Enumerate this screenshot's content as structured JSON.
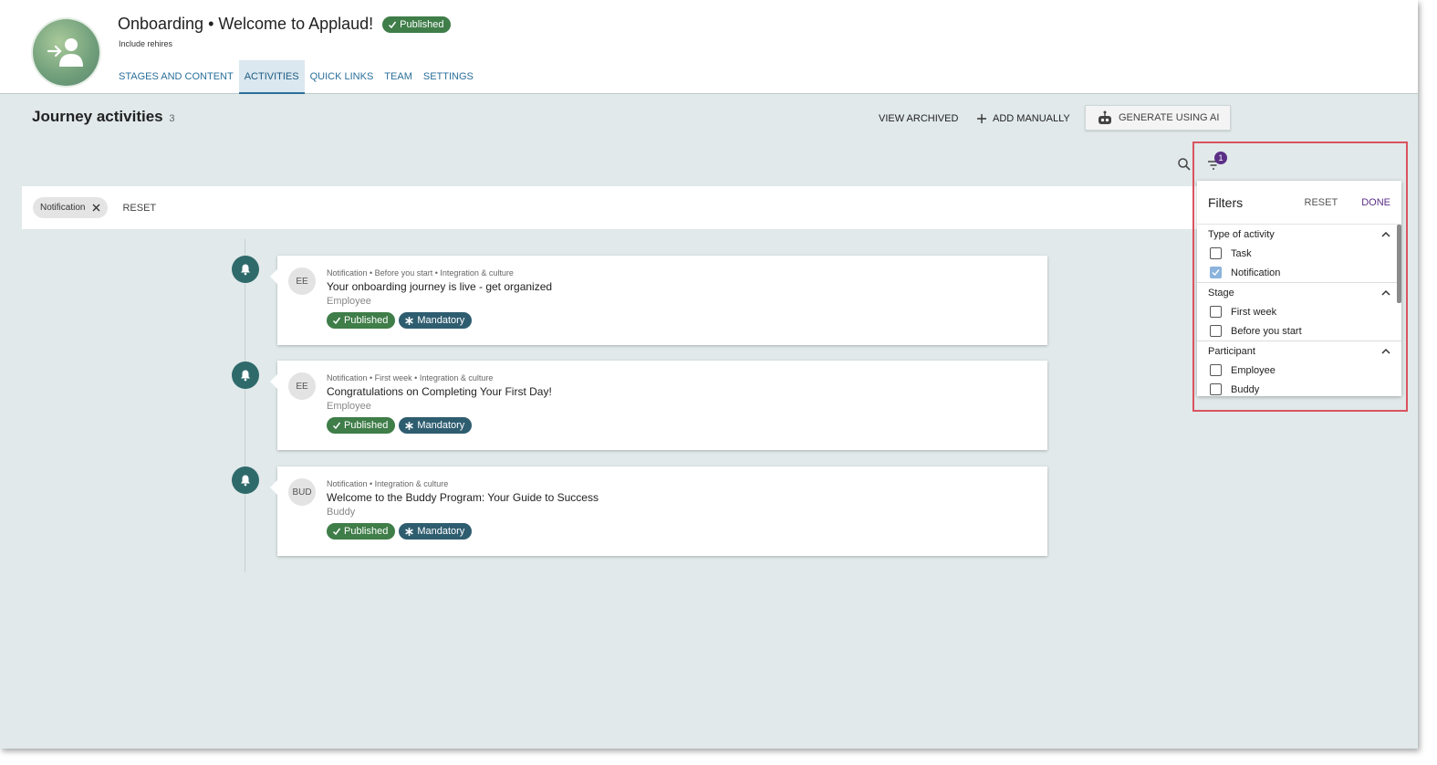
{
  "header": {
    "title": "Onboarding • Welcome to Applaud!",
    "status_badge": "Published",
    "subtitle": "Include rehires",
    "tabs": [
      {
        "label": "STAGES AND CONTENT"
      },
      {
        "label": "ACTIVITIES",
        "active": true
      },
      {
        "label": "QUICK LINKS"
      },
      {
        "label": "TEAM"
      },
      {
        "label": "SETTINGS"
      }
    ]
  },
  "toolbar": {
    "section_title": "Journey activities",
    "count": "3",
    "view_archived": "VIEW ARCHIVED",
    "add_manually": "ADD MANUALLY",
    "generate_ai": "GENERATE USING AI"
  },
  "chips": {
    "active_filter": "Notification",
    "reset": "RESET"
  },
  "filter_button": {
    "count": "1"
  },
  "activities": [
    {
      "initials": "EE",
      "meta": "Notification • Before you start • Integration & culture",
      "title": "Your onboarding journey is live - get organized",
      "role": "Employee",
      "status": "Published",
      "tag": "Mandatory"
    },
    {
      "initials": "EE",
      "meta": "Notification • First week • Integration & culture",
      "title": "Congratulations on Completing Your First Day!",
      "role": "Employee",
      "status": "Published",
      "tag": "Mandatory"
    },
    {
      "initials": "BUD",
      "meta": "Notification • Integration & culture",
      "title": "Welcome to the Buddy Program: Your Guide to Success",
      "role": "Buddy",
      "status": "Published",
      "tag": "Mandatory"
    }
  ],
  "filters_panel": {
    "title": "Filters",
    "reset": "RESET",
    "done": "DONE",
    "groups": [
      {
        "label": "Type of activity",
        "options": [
          {
            "label": "Task",
            "checked": false
          },
          {
            "label": "Notification",
            "checked": true
          }
        ]
      },
      {
        "label": "Stage",
        "options": [
          {
            "label": "First week",
            "checked": false
          },
          {
            "label": "Before you start",
            "checked": false
          }
        ]
      },
      {
        "label": "Participant",
        "options": [
          {
            "label": "Employee",
            "checked": false
          },
          {
            "label": "Buddy",
            "checked": false
          }
        ]
      }
    ]
  },
  "colors": {
    "accent": "#2a6f9b",
    "published_green": "#3f7d49",
    "mandatory_blue": "#2f5d70",
    "timeline_teal": "#2f6a6b",
    "purple": "#5b2f86",
    "highlight_red": "#d9545f",
    "page_bg": "#e1e9ea"
  }
}
